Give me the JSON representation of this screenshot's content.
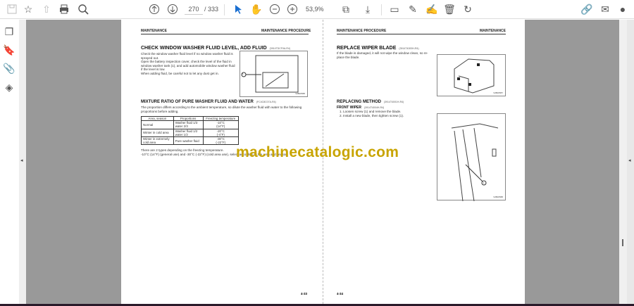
{
  "toolbar": {
    "page_current": "270",
    "page_total": "/ 333",
    "zoom": "53,9%",
    "icons": [
      "save-icon",
      "star-icon",
      "upload-icon",
      "print-icon",
      "find-icon",
      "page-up-icon",
      "page-down-icon",
      "select-cursor-icon",
      "hand-icon",
      "zoom-out-icon",
      "zoom-in-icon",
      "fit-page-icon",
      "scroll-mode-icon",
      "comment-icon",
      "highlight-icon",
      "sign-icon",
      "delete-icon",
      "rotate-icon",
      "share-link-icon",
      "email-icon",
      "account-icon"
    ]
  },
  "sidebar": {
    "icons": [
      "pages-icon",
      "bookmark-icon",
      "attachment-icon",
      "layers-icon"
    ]
  },
  "left_page": {
    "header_left": "MAINTENANCE",
    "header_right": "MAINTENANCE PROCEDURE",
    "s1_title": "CHECK WINDOW WASHER FLUID LEVEL, ADD FLUID",
    "s1_code": "(3914TDCFIIA-R4)",
    "s1_text": [
      "Check the window washer fluid level if no window washer fluid is",
      "sprayed out.",
      "Open the battery inspection cover, check the level of the fluid in",
      "window washer tank (1), and add automobile window washer fluid",
      "if the level is low.",
      "When adding fluid, be careful not to let any dust get in."
    ],
    "fig1_label": "1",
    "fig1_code": "9JB00588",
    "s2_title": "MIXTURE RATIO OF PURE WASHER FLUID AND WATER",
    "s2_code": "(FC4C8C07A-R4)",
    "s2_text": [
      "The proportion differs according to the ambient temperature, so dilute the washer fluid with water to the following",
      "proportions before adding."
    ],
    "table": {
      "headers": [
        "Area, season",
        "Proportions",
        "Freezing temperature"
      ],
      "rows": [
        [
          "Normal",
          "Washer fluid 1/3\nwater 2/3",
          "-10°C\n(14°F)"
        ],
        [
          "Winter in cold area",
          "Washer fluid 1/2\nwater 1/2",
          "-20°C\n(-4°F)"
        ],
        [
          "Winter in extremely\ncold area",
          "Pure washer fluid",
          "-30°C\n(-22°F)"
        ]
      ]
    },
    "s2_footer": [
      "There are 2 types depending on the freezing temperature.",
      "-10°C (14°F) (general use) and -30°C (-22°F) (cold area use), select according to the area and season."
    ],
    "page_number": "4-33"
  },
  "right_page": {
    "header_left": "MAINTENANCE PROCEDURE",
    "header_right": "MAINTENANCE",
    "s1_title": "REPLACE WIPER BLADE",
    "s1_code": "(3914T4000H-R4)",
    "s1_text": [
      "If the blade is damaged, it will not wipe the window clean, so re-",
      "place the blade."
    ],
    "fig1_code": "9JB00587",
    "s2_title": "REPLACING METHOD",
    "s2_code": "(3914T4001H-R4)",
    "s3_title": "FRONT WIPER",
    "s3_code": "(3914T4004H-R4)",
    "steps": [
      "1.  Loosen screw (1) and remove the blade.",
      "2.  Install a new blade, then tighten screw (1)."
    ],
    "fig2_label": "1",
    "fig2_code": "9JB00588",
    "page_number": "4-34"
  },
  "watermark": "machinecatalogic.com"
}
